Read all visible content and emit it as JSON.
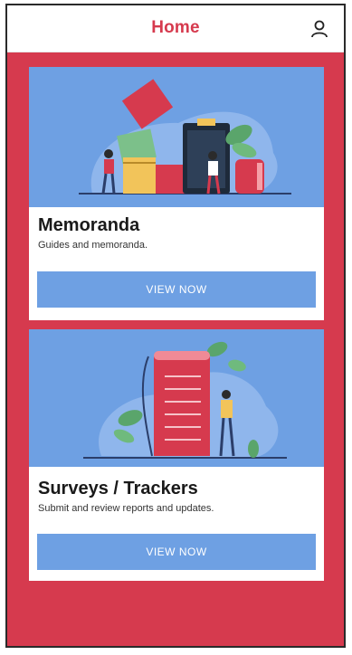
{
  "header": {
    "title": "Home",
    "profile_icon": "user-icon"
  },
  "colors": {
    "brand_red": "#d63a4e",
    "illustration_blue": "#6ea0e3",
    "button_blue": "#6ea0e3"
  },
  "cards": [
    {
      "title": "Memoranda",
      "description": "Guides and memoranda.",
      "button_label": "VIEW NOW",
      "illustration": "memoranda-illustration"
    },
    {
      "title": "Surveys / Trackers",
      "description": "Submit and review reports and updates.",
      "button_label": "VIEW NOW",
      "illustration": "surveys-illustration"
    }
  ]
}
